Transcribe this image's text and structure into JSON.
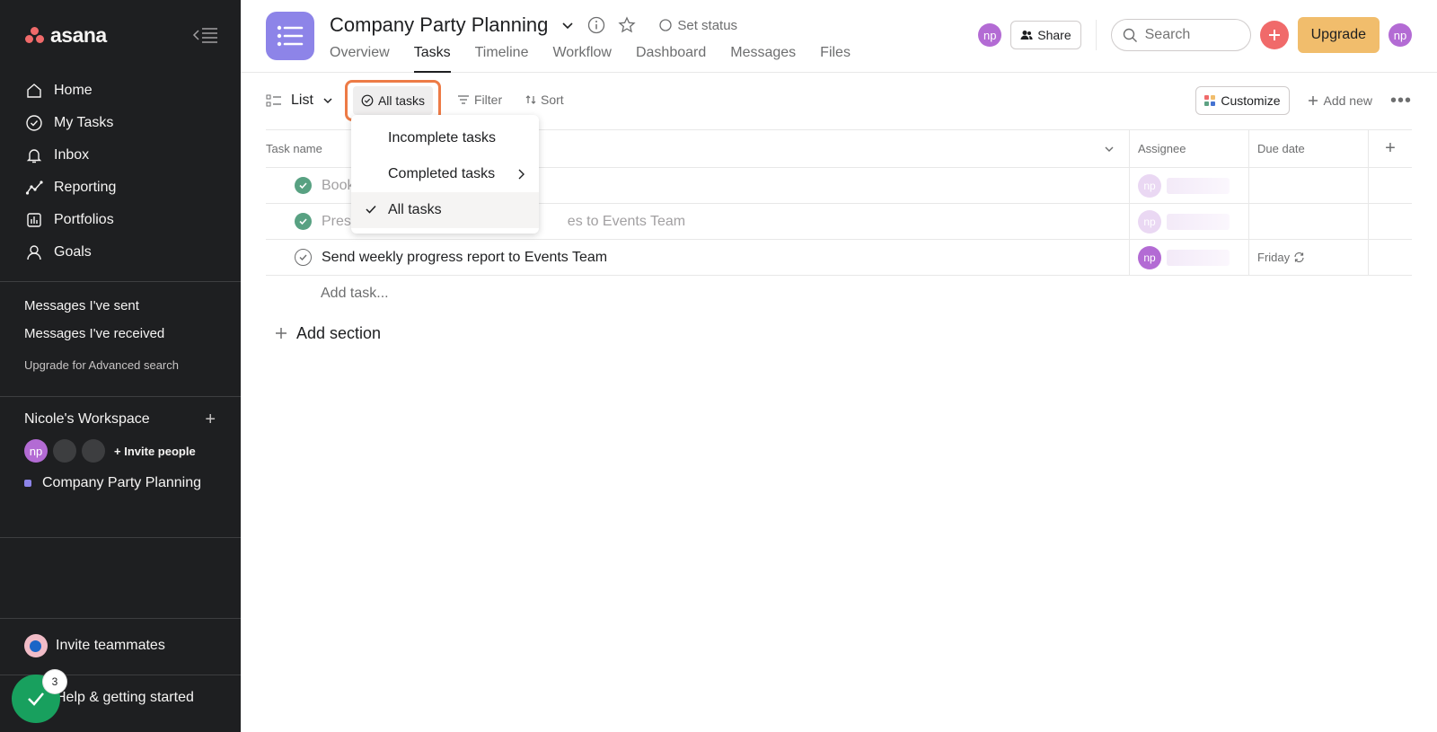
{
  "sidebar": {
    "logo": "asana",
    "nav": [
      {
        "label": "Home",
        "icon": "home-icon"
      },
      {
        "label": "My Tasks",
        "icon": "check-circle-icon"
      },
      {
        "label": "Inbox",
        "icon": "bell-icon"
      },
      {
        "label": "Reporting",
        "icon": "reporting-icon"
      },
      {
        "label": "Portfolios",
        "icon": "portfolio-icon"
      },
      {
        "label": "Goals",
        "icon": "goals-icon"
      }
    ],
    "messages_sent": "Messages I've sent",
    "messages_received": "Messages I've received",
    "upgrade_search": "Upgrade for Advanced search",
    "workspace": {
      "name": "Nicole's Workspace",
      "avatar_initials": "np",
      "invite_people": "Invite people",
      "project": "Company Party Planning"
    },
    "invite_teammates": "Invite teammates",
    "help": "Help & getting started",
    "help_badge": "3"
  },
  "header": {
    "title": "Company Party Planning",
    "set_status": "Set status",
    "tabs": [
      "Overview",
      "Tasks",
      "Timeline",
      "Workflow",
      "Dashboard",
      "Messages",
      "Files"
    ],
    "active_tab": "Tasks",
    "member_initials": "np",
    "share": "Share",
    "search_placeholder": "Search",
    "upgrade": "Upgrade",
    "user_initials": "np"
  },
  "toolbar": {
    "view": "List",
    "task_filter": "All tasks",
    "filter": "Filter",
    "sort": "Sort",
    "customize": "Customize",
    "add_new": "Add new"
  },
  "table": {
    "columns": {
      "name": "Task name",
      "assignee": "Assignee",
      "due": "Due date"
    },
    "rows": [
      {
        "name": "Book",
        "completed": true,
        "assignee": "np",
        "due": ""
      },
      {
        "name": "Prese",
        "name_tail": "es to Events Team",
        "completed": true,
        "assignee": "np",
        "due": ""
      },
      {
        "name": "Send weekly progress report to Events Team",
        "completed": false,
        "assignee": "np",
        "due": "Friday"
      }
    ],
    "add_task": "Add task...",
    "add_section": "Add section"
  },
  "dropdown": {
    "items": [
      "Incomplete tasks",
      "Completed tasks",
      "All tasks"
    ],
    "selected": "All tasks"
  },
  "colors": {
    "sidebar_bg": "#1e1f21",
    "accent_red": "#f06a6a",
    "upgrade_yellow": "#f1bd6c",
    "project_purple": "#8d84e8",
    "highlight_orange": "#ed7b46",
    "complete_green": "#58a182"
  }
}
